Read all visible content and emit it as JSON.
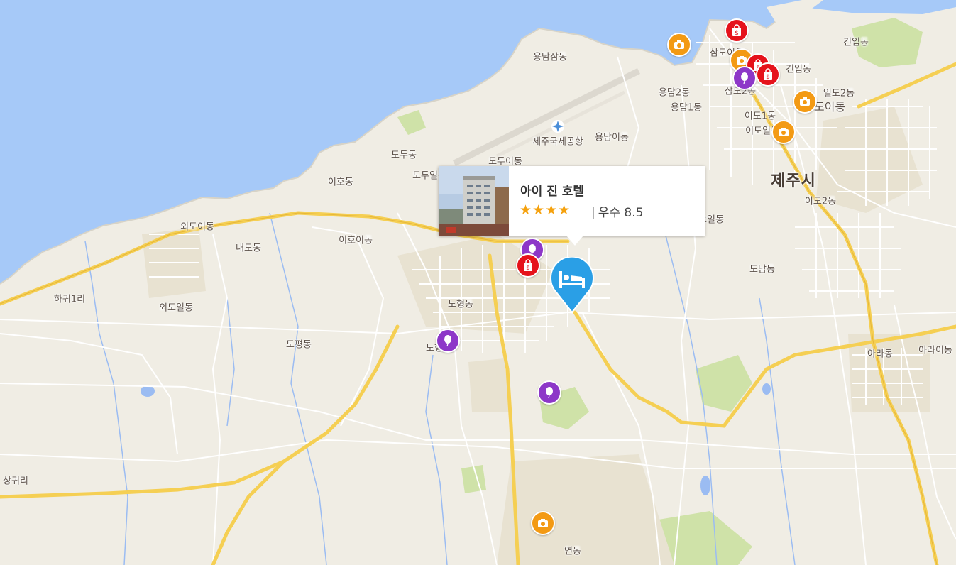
{
  "map": {
    "colors": {
      "sea": "#a6c9f8",
      "land": "#f0ede4",
      "major_road": "#f5cf53",
      "minor_road": "#ffffff",
      "green": "#cfe2a8",
      "water_line": "#9bbcf2"
    },
    "places": [
      {
        "name": "용담삼동"
      },
      {
        "name": "삼도이동"
      },
      {
        "name": "건입동"
      },
      {
        "name": "건입동"
      },
      {
        "name": "용담2동"
      },
      {
        "name": "삼도2동"
      },
      {
        "name": "일도2동"
      },
      {
        "name": "용담1동"
      },
      {
        "name": "이도1동"
      },
      {
        "name": "도이동"
      },
      {
        "name": "이도일동"
      },
      {
        "name": "제주국제공항"
      },
      {
        "name": "용담이동"
      },
      {
        "name": "도두동"
      },
      {
        "name": "도두이동"
      },
      {
        "name": "도두일동"
      },
      {
        "name": "이호동"
      },
      {
        "name": "제주시"
      },
      {
        "name": "이도2동"
      },
      {
        "name": "오일동"
      },
      {
        "name": "외도이동"
      },
      {
        "name": "내도동"
      },
      {
        "name": "이호이동"
      },
      {
        "name": "도남동"
      },
      {
        "name": "하귀1리"
      },
      {
        "name": "외도일동"
      },
      {
        "name": "노형동"
      },
      {
        "name": "도평동"
      },
      {
        "name": "노형"
      },
      {
        "name": "아라동"
      },
      {
        "name": "아라이동"
      },
      {
        "name": "상귀리"
      },
      {
        "name": "연동"
      }
    ],
    "markers": [
      {
        "type": "shop",
        "icon": "shopping-bag-icon"
      },
      {
        "type": "photo",
        "icon": "camera-icon"
      },
      {
        "type": "photo",
        "icon": "camera-icon"
      },
      {
        "type": "shop",
        "icon": "shopping-bag-icon"
      },
      {
        "type": "shop",
        "icon": "shopping-bag-icon"
      },
      {
        "type": "balloon",
        "icon": "balloon-icon"
      },
      {
        "type": "photo",
        "icon": "camera-icon"
      },
      {
        "type": "photo",
        "icon": "camera-icon"
      },
      {
        "type": "balloon",
        "icon": "balloon-icon"
      },
      {
        "type": "shop",
        "icon": "shopping-bag-icon"
      },
      {
        "type": "balloon",
        "icon": "balloon-icon"
      },
      {
        "type": "balloon",
        "icon": "balloon-icon"
      },
      {
        "type": "photo",
        "icon": "camera-icon"
      }
    ],
    "selected_hotel_icon": "bed-icon"
  },
  "popup": {
    "name": "아이 진 호텔",
    "stars": "★★★★",
    "star_count": 4,
    "separator": "|",
    "rating_label": "우수",
    "rating_score": "8.5"
  }
}
